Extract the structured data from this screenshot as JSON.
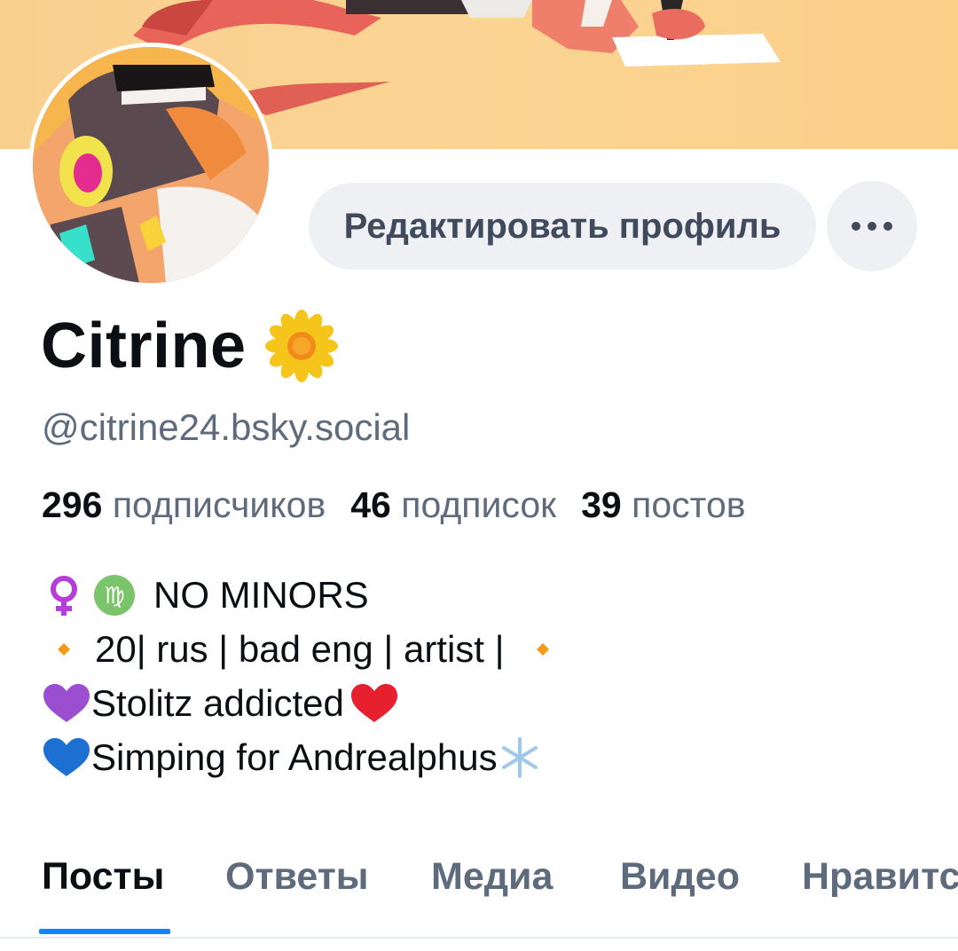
{
  "profile": {
    "display_name": "Citrine",
    "handle": "@citrine24.bsky.social",
    "edit_button_label": "Редактировать профиль",
    "more_button_icon": "ellipsis-icon",
    "name_emoji_icon": "sunflower-icon"
  },
  "stats": {
    "followers_count": "296",
    "followers_label": "подписчиков",
    "following_count": "46",
    "following_label": "подписок",
    "posts_count": "39",
    "posts_label": "постов"
  },
  "bio": {
    "line1": "NO MINORS",
    "line2": " 20| rus | bad eng | artist | ",
    "line3": "Stolitz addicted ",
    "line4": "Simping for Andrealphus"
  },
  "tabs": [
    {
      "label": "Посты",
      "active": true
    },
    {
      "label": "Ответы",
      "active": false
    },
    {
      "label": "Медиа",
      "active": false
    },
    {
      "label": "Видео",
      "active": false
    },
    {
      "label": "Нравится",
      "active": false
    }
  ],
  "colors": {
    "accent": "#1083fe",
    "banner": "#fbd493",
    "muted_text": "#5d6b7c",
    "button_bg": "#eef0f3"
  }
}
